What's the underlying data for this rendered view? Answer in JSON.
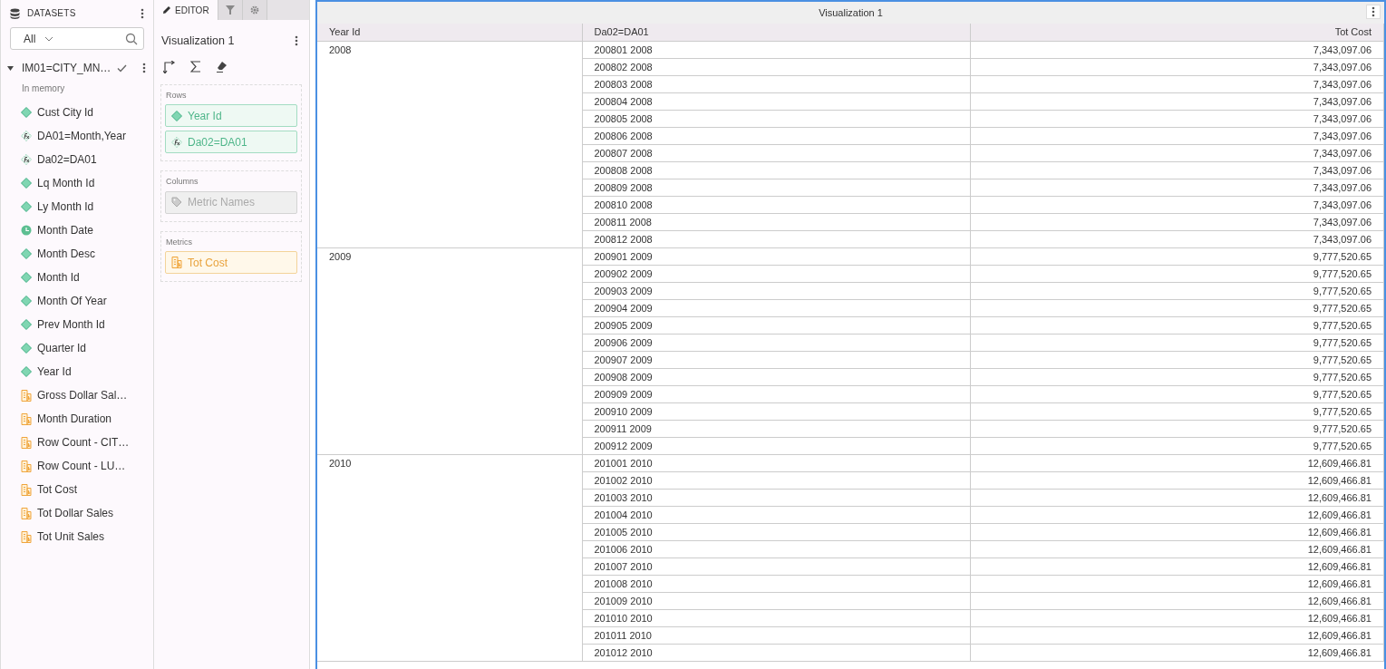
{
  "datasets_panel": {
    "title": "DATASETS",
    "filter": {
      "value": "All"
    },
    "dataset": {
      "name": "IM01=CITY_MN…",
      "expanded": true,
      "status": "In memory",
      "items": [
        {
          "kind": "attribute",
          "label": "Cust City Id"
        },
        {
          "kind": "derived",
          "label": "DA01=Month,Year"
        },
        {
          "kind": "derived",
          "label": "Da02=DA01"
        },
        {
          "kind": "attribute",
          "label": "Lq Month Id"
        },
        {
          "kind": "attribute",
          "label": "Ly Month Id"
        },
        {
          "kind": "date",
          "label": "Month Date"
        },
        {
          "kind": "attribute",
          "label": "Month Desc"
        },
        {
          "kind": "attribute",
          "label": "Month Id"
        },
        {
          "kind": "attribute",
          "label": "Month Of Year"
        },
        {
          "kind": "attribute",
          "label": "Prev Month Id"
        },
        {
          "kind": "attribute",
          "label": "Quarter Id"
        },
        {
          "kind": "attribute",
          "label": "Year Id"
        },
        {
          "kind": "metric",
          "label": "Gross Dollar Sal…"
        },
        {
          "kind": "metric",
          "label": "Month Duration"
        },
        {
          "kind": "metric",
          "label": "Row Count - CIT…"
        },
        {
          "kind": "metric",
          "label": "Row Count - LU…"
        },
        {
          "kind": "metric",
          "label": "Tot Cost"
        },
        {
          "kind": "metric",
          "label": "Tot Dollar Sales"
        },
        {
          "kind": "metric",
          "label": "Tot Unit Sales"
        }
      ]
    }
  },
  "editor_panel": {
    "tabs": [
      {
        "kind": "editor",
        "label": "EDITOR",
        "selected": true
      },
      {
        "kind": "filter",
        "selected": false
      },
      {
        "kind": "settings",
        "selected": false
      }
    ],
    "title": "Visualization 1",
    "zones": [
      {
        "label": "Rows",
        "items": [
          {
            "kind": "attribute",
            "label": "Year Id"
          },
          {
            "kind": "derived",
            "label": "Da02=DA01"
          }
        ]
      },
      {
        "label": "Columns",
        "items": [
          {
            "kind": "metric-names",
            "label": "Metric Names"
          }
        ]
      },
      {
        "label": "Metrics",
        "items": [
          {
            "kind": "metric",
            "label": "Tot Cost"
          }
        ]
      }
    ]
  },
  "visualization": {
    "title": "Visualization 1",
    "columns": [
      "Year Id",
      "Da02=DA01",
      "Tot Cost"
    ],
    "groups": [
      {
        "year": "2008",
        "rows": [
          [
            "200801 2008",
            "7,343,097.06"
          ],
          [
            "200802 2008",
            "7,343,097.06"
          ],
          [
            "200803 2008",
            "7,343,097.06"
          ],
          [
            "200804 2008",
            "7,343,097.06"
          ],
          [
            "200805 2008",
            "7,343,097.06"
          ],
          [
            "200806 2008",
            "7,343,097.06"
          ],
          [
            "200807 2008",
            "7,343,097.06"
          ],
          [
            "200808 2008",
            "7,343,097.06"
          ],
          [
            "200809 2008",
            "7,343,097.06"
          ],
          [
            "200810 2008",
            "7,343,097.06"
          ],
          [
            "200811 2008",
            "7,343,097.06"
          ],
          [
            "200812 2008",
            "7,343,097.06"
          ]
        ]
      },
      {
        "year": "2009",
        "rows": [
          [
            "200901 2009",
            "9,777,520.65"
          ],
          [
            "200902 2009",
            "9,777,520.65"
          ],
          [
            "200903 2009",
            "9,777,520.65"
          ],
          [
            "200904 2009",
            "9,777,520.65"
          ],
          [
            "200905 2009",
            "9,777,520.65"
          ],
          [
            "200906 2009",
            "9,777,520.65"
          ],
          [
            "200907 2009",
            "9,777,520.65"
          ],
          [
            "200908 2009",
            "9,777,520.65"
          ],
          [
            "200909 2009",
            "9,777,520.65"
          ],
          [
            "200910 2009",
            "9,777,520.65"
          ],
          [
            "200911 2009",
            "9,777,520.65"
          ],
          [
            "200912 2009",
            "9,777,520.65"
          ]
        ]
      },
      {
        "year": "2010",
        "rows": [
          [
            "201001 2010",
            "12,609,466.81"
          ],
          [
            "201002 2010",
            "12,609,466.81"
          ],
          [
            "201003 2010",
            "12,609,466.81"
          ],
          [
            "201004 2010",
            "12,609,466.81"
          ],
          [
            "201005 2010",
            "12,609,466.81"
          ],
          [
            "201006 2010",
            "12,609,466.81"
          ],
          [
            "201007 2010",
            "12,609,466.81"
          ],
          [
            "201008 2010",
            "12,609,466.81"
          ],
          [
            "201009 2010",
            "12,609,466.81"
          ],
          [
            "201010 2010",
            "12,609,466.81"
          ],
          [
            "201011 2010",
            "12,609,466.81"
          ],
          [
            "201012 2010",
            "12,609,466.81"
          ]
        ]
      }
    ]
  }
}
